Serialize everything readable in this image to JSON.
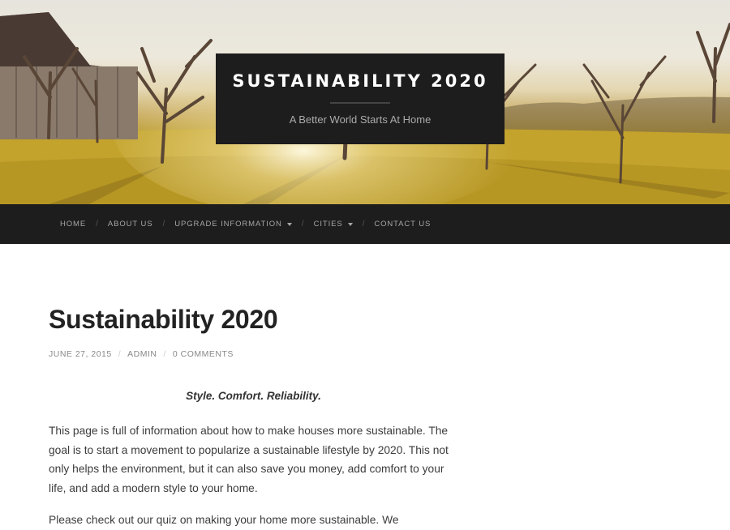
{
  "site": {
    "title": "SUSTAINABILITY 2020",
    "description": "A Better World Starts At Home"
  },
  "nav": {
    "items": [
      {
        "label": "HOME",
        "dropdown": false
      },
      {
        "label": "ABOUT US",
        "dropdown": false
      },
      {
        "label": "UPGRADE INFORMATION",
        "dropdown": true
      },
      {
        "label": "CITIES",
        "dropdown": true
      },
      {
        "label": "CONTACT US",
        "dropdown": false
      }
    ],
    "separator": "/"
  },
  "post": {
    "title": "Sustainability 2020",
    "date": "JUNE 27, 2015",
    "author": "ADMIN",
    "comments": "0 COMMENTS",
    "meta_separator": "/",
    "tagline": "Style. Comfort. Reliability.",
    "paragraph1": "This page is full of information about how to make houses more sustainable. The goal is to start a movement to popularize a sustainable lifestyle by 2020. This not only helps the environment, but it can also save you money, add comfort to your life, and add a modern style to your home.",
    "paragraph2": "Please check out our quiz on making your home more sustainable. We"
  },
  "colors": {
    "dark_bar": "#1d1d1d",
    "field_gold": "#c4a52a",
    "nav_text": "#a6a6a6"
  }
}
